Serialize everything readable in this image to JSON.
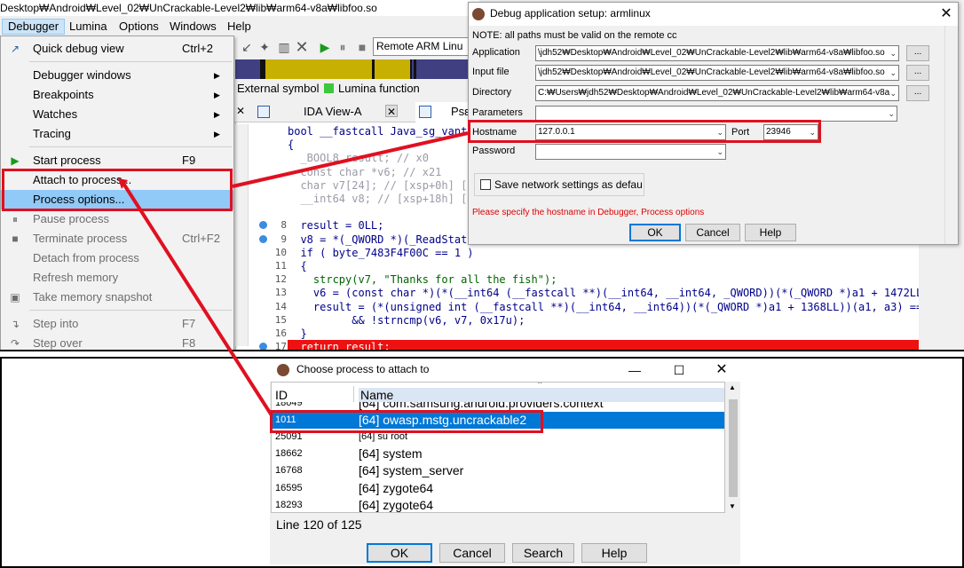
{
  "window": {
    "title": "Desktop₩Android₩Level_02₩UnCrackable-Level2₩lib₩arm64-v8a₩libfoo.so"
  },
  "menubar": [
    "Debugger",
    "Lumina",
    "Options",
    "Windows",
    "Help"
  ],
  "toolbar": {
    "debugger_select": "Remote ARM Linu"
  },
  "legend": {
    "external": "External symbol",
    "lumina": "Lumina function"
  },
  "tabs": {
    "ida_view": "IDA View-A",
    "pseudo": "Psε"
  },
  "debugger_menu": [
    {
      "label": "Quick debug view",
      "shortcut": "Ctrl+2"
    },
    {
      "label": "Debugger windows"
    },
    {
      "label": "Breakpoints"
    },
    {
      "label": "Watches"
    },
    {
      "label": "Tracing"
    },
    {
      "label": "Start process",
      "shortcut": "F9"
    },
    {
      "label": "Attach to process..."
    },
    {
      "label": "Process options..."
    },
    {
      "label": "Pause process"
    },
    {
      "label": "Terminate process",
      "shortcut": "Ctrl+F2"
    },
    {
      "label": "Detach from process"
    },
    {
      "label": "Refresh memory"
    },
    {
      "label": "Take memory snapshot"
    },
    {
      "label": "Step into",
      "shortcut": "F7"
    },
    {
      "label": "Step over",
      "shortcut": "F8"
    }
  ],
  "code": {
    "line_numbers": [
      "",
      "",
      "",
      "",
      "",
      "",
      "",
      "8",
      "9",
      "10",
      "11",
      "12",
      "13",
      "14",
      "15",
      "16",
      "17"
    ],
    "lines": [
      "bool __fastcall Java_sg_vant",
      "{",
      "  _BOOL8 result; // x0",
      "  const char *v6; // x21",
      "  char v7[24]; // [xsp+0h] [x",
      "  __int64 v8; // [xsp+18h] [x",
      "",
      "  result = 0LL;",
      "  v8 = *(_QWORD *)(_ReadStatu",
      "  if ( byte_7483F4F00C == 1 )",
      "  {",
      "    strcpy(v7, \"Thanks for all the fish\");",
      "    v6 = (const char *)(*(__int64 (__fastcall **)(__int64, __int64, _QWORD))(*(_QWORD *)a1 + 1472LL))(a",
      "    result = (*(unsigned int (__fastcall **)(__int64, __int64))(*(_QWORD *)a1 + 1368LL))(a1, a3) == 23",
      "          && !strncmp(v6, v7, 0x17u);",
      "  }",
      "  return result;"
    ]
  },
  "setup_dialog": {
    "title": "Debug application setup: armlinux",
    "note": "NOTE: all paths must be valid on the remote cc",
    "application_label": "Application",
    "application_value": "\\jdh52₩Desktop₩Android₩Level_02₩UnCrackable-Level2₩lib₩arm64-v8a₩libfoo.so",
    "input_file_label": "Input file",
    "input_file_value": "\\jdh52₩Desktop₩Android₩Level_02₩UnCrackable-Level2₩lib₩arm64-v8a₩libfoo.so",
    "directory_label": "Directory",
    "directory_value": "C:₩Users₩jdh52₩Desktop₩Android₩Level_02₩UnCrackable-Level2₩lib₩arm64-v8a",
    "parameters_label": "Parameters",
    "hostname_label": "Hostname",
    "hostname_value": "127.0.0.1",
    "port_label": "Port",
    "port_value": "23946",
    "password_label": "Password",
    "save_label": "Save network settings as defau",
    "error": "Please specify the hostname in Debugger, Process options",
    "ok": "OK",
    "cancel": "Cancel",
    "help": "Help",
    "browse": "..."
  },
  "choose_dialog": {
    "title": "Choose process to attach to",
    "col_id": "ID",
    "col_name": "Name",
    "rows": [
      {
        "id": "18049",
        "name": "[64] com.samsung.android.providers.context"
      },
      {
        "id": "1011",
        "name": "[64] owasp.mstg.uncrackable2",
        "selected": true
      },
      {
        "id": "25091",
        "name": "[64] su root"
      },
      {
        "id": "18662",
        "name": "[64] system"
      },
      {
        "id": "16768",
        "name": "[64] system_server"
      },
      {
        "id": "16595",
        "name": "[64] zygote64"
      },
      {
        "id": "18293",
        "name": "[64] zygote64"
      }
    ],
    "status": "Line 120 of 125",
    "ok": "OK",
    "cancel": "Cancel",
    "search": "Search",
    "help": "Help"
  },
  "colors": {
    "annotation": "#e01020",
    "selection": "#0078d7",
    "menu_highlight": "#91c9f7",
    "lumina": "#3cc83c"
  }
}
